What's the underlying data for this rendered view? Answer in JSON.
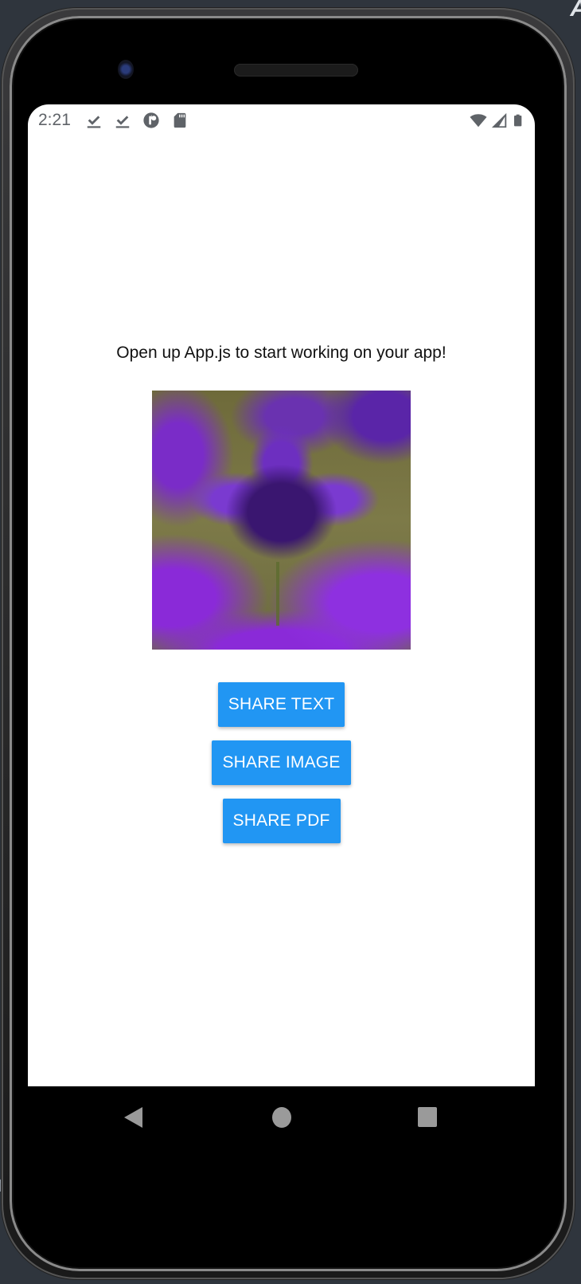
{
  "status_bar": {
    "time": "2:21",
    "left_icons": [
      "download-done-icon",
      "download-done-icon",
      "data-saver-icon",
      "sd-card-icon"
    ],
    "right_icons": [
      "wifi-icon",
      "cellular-signal-icon",
      "battery-icon"
    ]
  },
  "main": {
    "intro_text": "Open up App.js to start working on your app!",
    "image_alt": "Purple iris flower with water droplets",
    "buttons": [
      {
        "label": "SHARE TEXT"
      },
      {
        "label": "SHARE IMAGE"
      },
      {
        "label": "SHARE PDF"
      }
    ]
  },
  "nav_bar": {
    "buttons": [
      "back",
      "home",
      "recents"
    ]
  },
  "colors": {
    "button_bg": "#2196f3",
    "button_text": "#ffffff",
    "nav_icon": "#9a9a9a",
    "status_icon": "#5f6368"
  }
}
